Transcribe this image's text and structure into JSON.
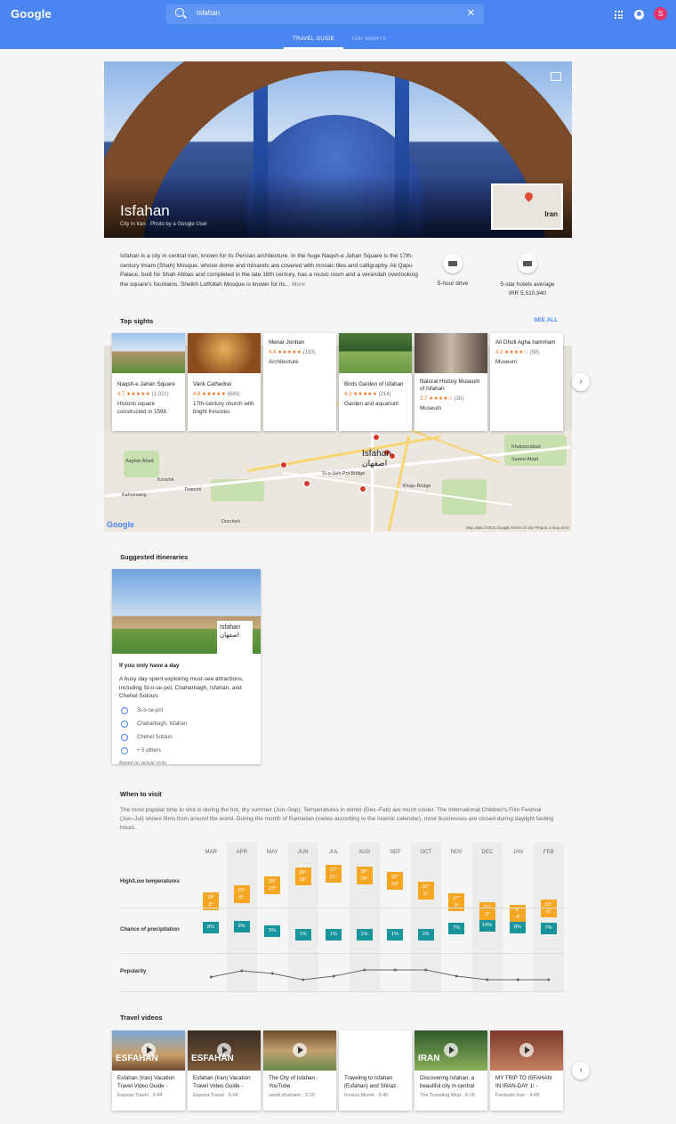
{
  "header": {
    "logo": "Google",
    "search_value": "Isfahan",
    "tabs": [
      {
        "label": "TRAVEL GUIDE"
      },
      {
        "label": "TOP SIGHTS"
      }
    ],
    "avatar_letter": "S"
  },
  "hero": {
    "title": "Isfahan",
    "subtitle": "City in Iran · Photo by a Google User",
    "minimap_label": "Iran"
  },
  "description": {
    "text": "Isfahan is a city in central Iran, known for its Persian architecture. In the huge Naqsh-e Jahan Square is the 17th-century Imam (Shah) Mosque, whose dome and minarets are covered with mosaic tiles and calligraphy. Ali Qapu Palace, built for Shah Abbas and completed in the late 16th century, has a music room and a verandah overlooking the square's fountains. Sheikh Lotfollah Mosque is known for its...",
    "more": "More"
  },
  "quick_facts": [
    {
      "label": "5-hour drive"
    },
    {
      "label": "5-star hotels average IRR 5,510,940"
    }
  ],
  "top_sights": {
    "title": "Top sights",
    "see_all": "SEE ALL",
    "cards": [
      {
        "name": "Naqsh-e Jahan Square",
        "rating": "4.7 ★★★★★",
        "reviews": "(1,021)",
        "category": "Historic square constructed in 1598"
      },
      {
        "name": "Vank Cathedral",
        "rating": "4.6 ★★★★★",
        "reviews": "(649)",
        "category": "17th-century church with bright frescoes"
      },
      {
        "name": "Menar Jonban",
        "rating": "4.4 ★★★★★",
        "reviews": "(193)",
        "category": "Architecture"
      },
      {
        "name": "Birds Garden of Isfahan",
        "rating": "4.3 ★★★★★",
        "reviews": "(214)",
        "category": "Garden and aquarium"
      },
      {
        "name": "Natural History Museum of Isfahan",
        "rating": "3.7 ★★★★☆",
        "reviews": "(30)",
        "category": "Museum"
      },
      {
        "name": "Ali Gholi Agha hammam",
        "rating": "4.2 ★★★★☆",
        "reviews": "(58)",
        "category": "Museum"
      }
    ]
  },
  "map": {
    "city": "Isfahan",
    "city_fa": "اصفهان",
    "labels": [
      "Asghar Abad",
      "Kooshk",
      "Tiranchi",
      "Kahrizsang",
      "Dorcheh",
      "Si-o-Seh Pol Bridge",
      "Khaju Bridge",
      "Khatoonabad",
      "Saeed Abad"
    ],
    "google": "Google",
    "footer": "Map data ©2018 Google   Terms of Use   Report a map error"
  },
  "itineraries": {
    "title": "Suggested itineraries",
    "card": {
      "heading": "If you only have a day",
      "text": "A busy day spent exploring must-see attractions, including Si-o-se-pol, Chaharbagh, Isfahan, and Chehel Sotoun.",
      "stops": [
        "Si-o-se-pol",
        "Chaharbagh, Isfahan",
        "Chehel Sotoun",
        "+ 5 others"
      ],
      "note": "Based on actual visits",
      "overlay": "Isfahan اصفهان"
    }
  },
  "when": {
    "title": "When to visit",
    "text": "The most popular time to visit is during the hot, dry summer (Jun–Sep). Temperatures in winter (Dec–Feb) are much cooler. The International Children's Film Festival (Jun–Jul) shows films from around the world. During the month of Ramadan (varies according to the Islamic calendar), most businesses are closed during daylight fasting hours.",
    "row_labels": [
      "High/Low temperatures",
      "Chance of precipitation",
      "Popularity"
    ],
    "months": [
      {
        "m": "MAR",
        "hi": "18°",
        "lo": "3°",
        "p": "8%",
        "pop": 0.25
      },
      {
        "m": "APR",
        "hi": "23°",
        "lo": "8°",
        "p": "9%",
        "pop": 0.6
      },
      {
        "m": "MAY",
        "hi": "29°",
        "lo": "13°",
        "p": "5%",
        "pop": 0.45
      },
      {
        "m": "JUN",
        "hi": "35°",
        "lo": "18°",
        "p": "1%",
        "pop": 0.1
      },
      {
        "m": "JUL",
        "hi": "37°",
        "lo": "21°",
        "p": "1%",
        "pop": 0.3
      },
      {
        "m": "AUG",
        "hi": "36°",
        "lo": "19°",
        "p": "1%",
        "pop": 0.65
      },
      {
        "m": "SEP",
        "hi": "32°",
        "lo": "14°",
        "p": "1%",
        "pop": 0.65
      },
      {
        "m": "OCT",
        "hi": "25°",
        "lo": "9°",
        "p": "1%",
        "pop": 0.65
      },
      {
        "m": "NOV",
        "hi": "17°",
        "lo": "3°",
        "p": "7%",
        "pop": 0.3
      },
      {
        "m": "DEC",
        "hi": "11°",
        "lo": "-2°",
        "p": "10%",
        "pop": 0.1
      },
      {
        "m": "JAN",
        "hi": "9°",
        "lo": "-4°",
        "p": "8%",
        "pop": 0.1
      },
      {
        "m": "FEB",
        "hi": "13°",
        "lo": "-2°",
        "p": "7%",
        "pop": 0.1
      }
    ]
  },
  "videos": {
    "title": "Travel videos",
    "items": [
      {
        "title": "Esfahan (Iran) Vacation Travel Video Guide -",
        "meta": "Expoza Travel · 9:44",
        "overlay": "ESFAHAN"
      },
      {
        "title": "Esfahan (Iran) Vacation Travel Video Guide -",
        "meta": "Expoza Travel · 5:04",
        "overlay": "ESFAHAN"
      },
      {
        "title": "The City of Isfahan - YouTube",
        "meta": "navid shahram · 2:10",
        "overlay": ""
      },
      {
        "title": "Traveling to Isfahan (Esfahan) and Shiraz.",
        "meta": "Invisus Mundi · 9:45",
        "overlay": ""
      },
      {
        "title": "Discovering Isfahan, a beautiful city in central",
        "meta": "The Traveling Wop · 6:18",
        "overlay": "IRAN"
      },
      {
        "title": "MY TRIP TO ISFAHAN IN IRAN-DAY 1! -",
        "meta": "Fantastic Iran · 4:49",
        "overlay": ""
      }
    ]
  }
}
